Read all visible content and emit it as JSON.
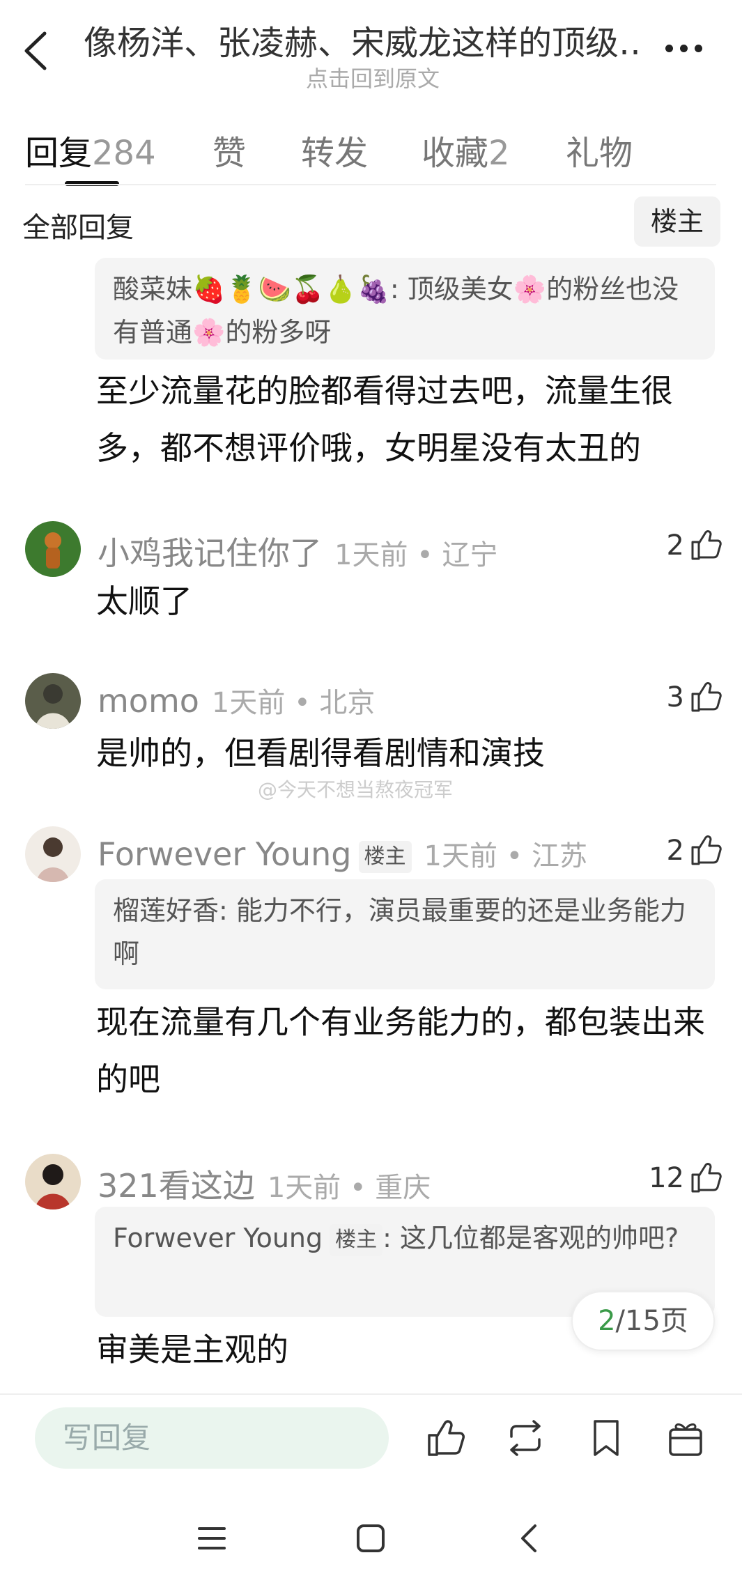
{
  "header": {
    "title": "像杨洋、张凌赫、宋威龙这样的顶级…",
    "subtitle": "点击回到原文"
  },
  "tabs": [
    {
      "label": "回复",
      "count": "284"
    },
    {
      "label": "赞",
      "count": ""
    },
    {
      "label": "转发",
      "count": ""
    },
    {
      "label": "收藏",
      "count": "2"
    },
    {
      "label": "礼物",
      "count": ""
    }
  ],
  "filter": {
    "all_label": "全部回复",
    "op_label": "楼主"
  },
  "top_fragment": {
    "quote_name": "酸菜妹🍓🍍🍉🍒🍐🍇",
    "quote_text": ": 顶级美女🌸的粉丝也没有普通🌸的粉多呀",
    "body": "至少流量花的脸都看得过去吧，流量生很多，都不想评价哦，女明星没有太丑的"
  },
  "comments": [
    {
      "name": "小鸡我记住你了",
      "time": "1天前",
      "location": "辽宁",
      "likes": "2",
      "body": "太顺了"
    },
    {
      "name": "momo",
      "time": "1天前",
      "location": "北京",
      "likes": "3",
      "body": "是帅的，但看剧得看剧情和演技"
    },
    {
      "name": "Forwever Young",
      "badge": "楼主",
      "time": "1天前",
      "location": "江苏",
      "likes": "2",
      "quote_name": "榴莲好香",
      "quote_text": ": 能力不行，演员最重要的还是业务能力啊",
      "body": "现在流量有几个有业务能力的，都包装出来的吧"
    },
    {
      "name": "321看这边",
      "time": "1天前",
      "location": "重庆",
      "likes": "12",
      "quote_name": "Forwever Young",
      "quote_badge": "楼主",
      "quote_text": ": 这几位都是客观的帅吧?",
      "body": "审美是主观的"
    }
  ],
  "meta_separator": "•",
  "watermark": "@今天不想当熬夜冠军",
  "pagination": {
    "current": "2",
    "total_text": "/15页"
  },
  "bottom": {
    "reply_placeholder": "写回复",
    "actions": [
      "like-icon",
      "repost-icon",
      "bookmark-icon",
      "gift-icon"
    ]
  },
  "colors": {
    "accent_green": "#3a9a48",
    "input_bg": "#eaf5ee"
  }
}
